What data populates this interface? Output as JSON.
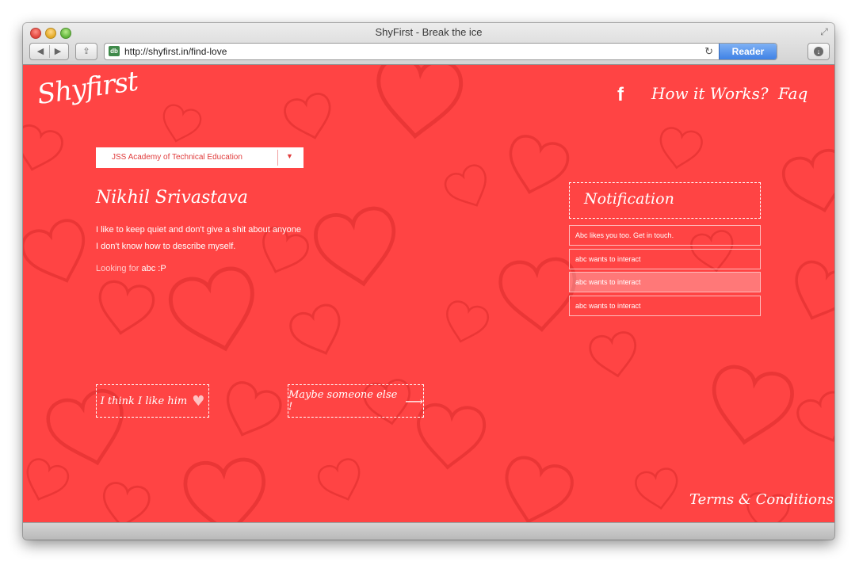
{
  "browser": {
    "window_title": "ShyFirst - Break the ice",
    "url": "http://shyfirst.in/find-love",
    "reader_label": "Reader",
    "back_icon": "back-icon",
    "forward_icon": "forward-icon",
    "share_icon": "share-icon",
    "reload_icon": "reload-icon",
    "download_icon": "download-icon"
  },
  "site": {
    "logo": "Shyfirst",
    "nav": {
      "facebook_icon": "f",
      "how_it_works": "How it Works?",
      "faq": "Faq"
    },
    "college_select": {
      "selected": "JSS Academy of Technical Education",
      "arrow": "▼"
    },
    "profile": {
      "name": "Nikhil Srivastava",
      "bio_line_1": "I like to keep quiet and don't give a shit about anyone",
      "bio_line_2": "I don't know how to describe myself.",
      "looking_for_label": "Looking for",
      "looking_for_value": "abc :P"
    },
    "actions": {
      "like_label": "I think I like him",
      "skip_label": "Maybe someone else !"
    },
    "notifications": {
      "title": "Notification",
      "items": [
        "Abc likes you too. Get in touch.",
        "abc wants to interact",
        "abc wants to interact",
        "abc wants to interact"
      ]
    },
    "footer": {
      "terms": "Terms & Conditions"
    }
  },
  "colors": {
    "page_background": "#ff4444",
    "accent": "#ffffff",
    "heart_pattern": "#e83535"
  }
}
